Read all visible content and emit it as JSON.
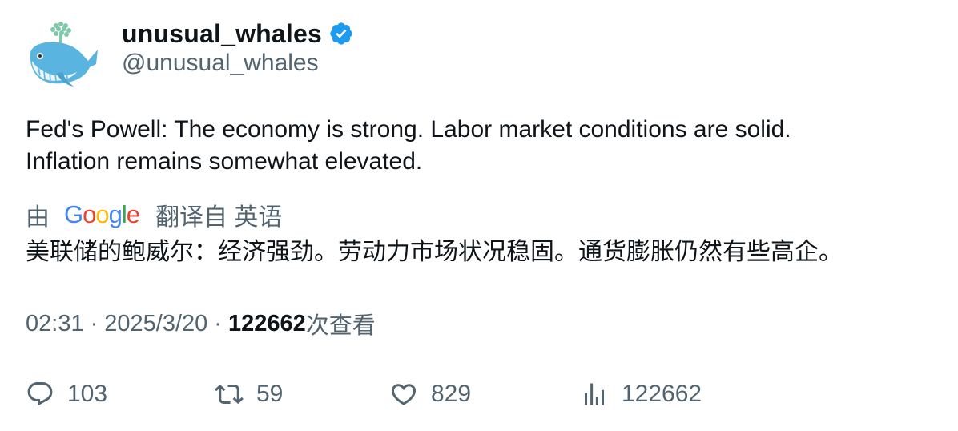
{
  "tweet": {
    "display_name": "unusual_whales",
    "handle": "@unusual_whales",
    "text_line1": "Fed's Powell: The economy is strong. Labor market conditions are solid.",
    "text_line2": "Inflation remains somewhat elevated.",
    "translate_prefix": "由",
    "translate_brand": "Google",
    "translate_suffix": "翻译自 英语",
    "translated_text": "美联储的鲍威尔：经济强劲。劳动力市场状况稳固。通货膨胀仍然有些高企。",
    "time": "02:31",
    "date": "2025/3/20",
    "dot": "·",
    "views_count": "122662",
    "views_label": "次查看"
  },
  "actions": {
    "replies": "103",
    "retweets": "59",
    "likes": "829",
    "views": "122662"
  },
  "colors": {
    "text": "#0f1419",
    "secondary": "#536471",
    "verified": "#1d9bf0",
    "whale": "#5ab4e0"
  }
}
